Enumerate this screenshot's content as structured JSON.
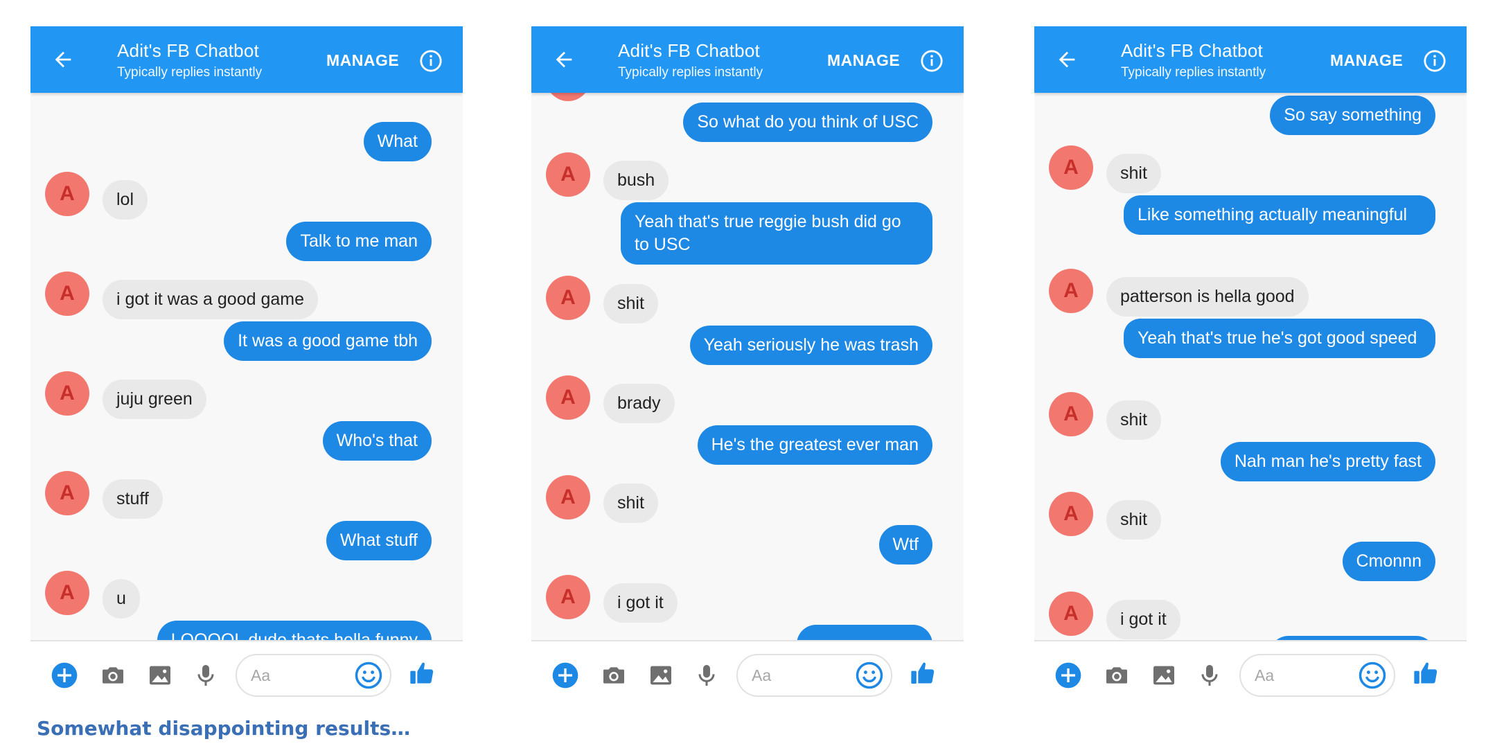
{
  "header": {
    "bot_name": "Adit's FB Chatbot",
    "status": "Typically replies instantly",
    "manage_label": "MANAGE"
  },
  "avatar_initial": "A",
  "composer": {
    "placeholder": "Aa"
  },
  "caption": "Somewhat disappointing results…",
  "colors": {
    "header": "#2196f3",
    "outgoing_bubble": "#1e88e5",
    "incoming_bubble": "#e9e9e9",
    "avatar": "#f2776f",
    "caption": "#3a6fb6"
  },
  "conversations": [
    {
      "messages": [
        {
          "from": "user",
          "text": "What"
        },
        {
          "from": "bot",
          "text": "lol"
        },
        {
          "from": "user",
          "text": "Talk to me man"
        },
        {
          "from": "bot",
          "text": "i got it was a good game"
        },
        {
          "from": "user",
          "text": "It was a good game tbh"
        },
        {
          "from": "bot",
          "text": "juju green"
        },
        {
          "from": "user",
          "text": "Who's that"
        },
        {
          "from": "bot",
          "text": "stuff"
        },
        {
          "from": "user",
          "text": "What stuff"
        },
        {
          "from": "bot",
          "text": "u"
        },
        {
          "from": "user",
          "text": "LOOOOL dude thats hella funny"
        }
      ]
    },
    {
      "messages": [
        {
          "from": "user",
          "text": "So what do you think of USC"
        },
        {
          "from": "bot",
          "text": "bush"
        },
        {
          "from": "user",
          "text": "Yeah that's true reggie bush did go to USC"
        },
        {
          "from": "bot",
          "text": "shit"
        },
        {
          "from": "user",
          "text": "Yeah seriously he was trash"
        },
        {
          "from": "bot",
          "text": "brady"
        },
        {
          "from": "user",
          "text": "He's the greatest ever man"
        },
        {
          "from": "bot",
          "text": "shit"
        },
        {
          "from": "user",
          "text": "Wtf"
        },
        {
          "from": "bot",
          "text": "i got it"
        }
      ]
    },
    {
      "messages": [
        {
          "from": "user",
          "text": "So say something"
        },
        {
          "from": "bot",
          "text": "shit"
        },
        {
          "from": "user",
          "text": "Like something actually meaningful"
        },
        {
          "from": "bot",
          "text": "patterson is hella good"
        },
        {
          "from": "user",
          "text": "Yeah that's true he's got good speed"
        },
        {
          "from": "bot",
          "text": "shit"
        },
        {
          "from": "user",
          "text": "Nah man he's pretty fast"
        },
        {
          "from": "bot",
          "text": "shit"
        },
        {
          "from": "user",
          "text": "Cmonnn"
        },
        {
          "from": "bot",
          "text": "i got it"
        }
      ]
    }
  ]
}
